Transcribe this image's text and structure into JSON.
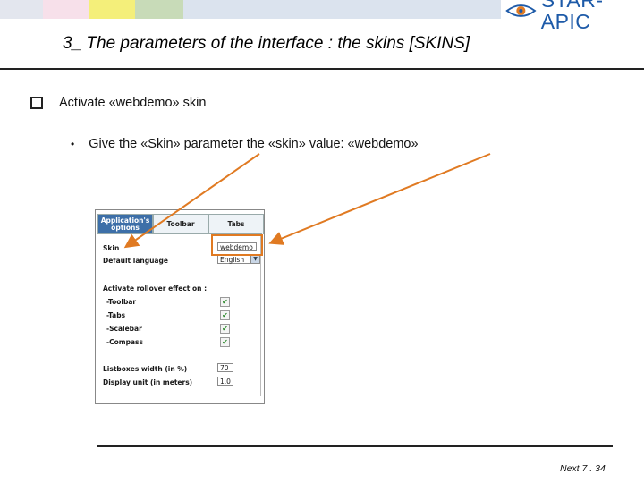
{
  "header": {
    "strip_colors": [
      "#e3e6ee",
      "#f7e0ea",
      "#f4ef7a",
      "#c8dbb8",
      "#b4cea4",
      "#dbe3ee"
    ],
    "logo_text": "STAR-APIC",
    "logo_color": "#1d5aa8",
    "accent": "#e07a22"
  },
  "slide": {
    "title": "3_ The parameters of the interface : the skins [SKINS]",
    "bullet1": "Activate «webdemo» skin",
    "bullet2": "Give the «Skin» parameter the «skin» value: «webdemo»"
  },
  "form": {
    "tabs": [
      "Application's options",
      "Toolbar",
      "Tabs"
    ],
    "skin_label": "Skin",
    "skin_value": "webdemo",
    "language_label": "Default language",
    "language_value": "English",
    "rollover_heading": "Activate rollover effect on :",
    "rollover_items": [
      "-Toolbar",
      "-Tabs",
      "-Scalebar",
      "-Compass"
    ],
    "checkmark": "✔",
    "listbox_label": "Listboxes width (in %)",
    "listbox_value": "70",
    "display_unit_label": "Display unit (in meters)",
    "display_unit_value": "1.0"
  },
  "footer": {
    "text": "Next 7 . 34"
  }
}
